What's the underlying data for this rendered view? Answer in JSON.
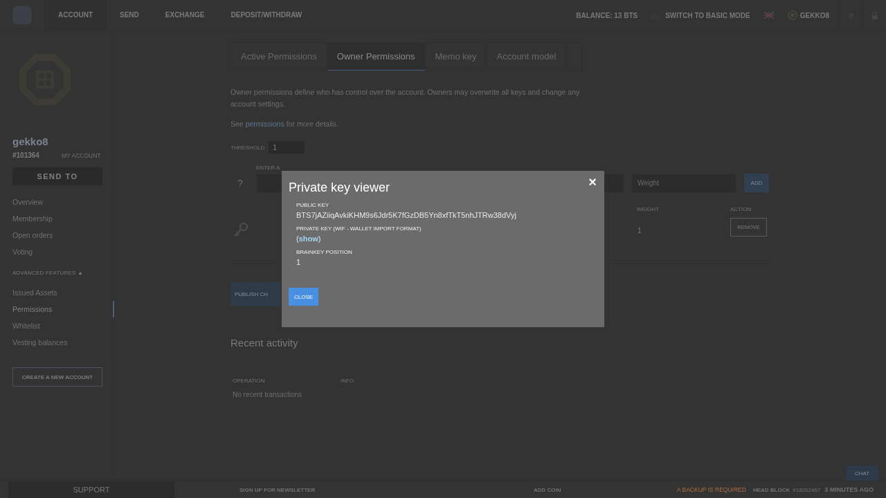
{
  "header": {
    "nav": [
      {
        "label": "ACCOUNT",
        "selected": true
      },
      {
        "label": "SEND",
        "selected": false
      },
      {
        "label": "EXCHANGE",
        "selected": false
      },
      {
        "label": "DEPOSIT/WITHDRAW",
        "selected": false
      }
    ],
    "balance": "BALANCE: 13 BTS",
    "mode": "SWITCH TO BASIC MODE",
    "account": "GEKKO8"
  },
  "sidebar": {
    "name": "gekko8",
    "id": "#101364",
    "my_account": "MY ACCOUNT",
    "send_button": "SEND TO",
    "items": [
      {
        "label": "Overview",
        "selected": false
      },
      {
        "label": "Membership",
        "selected": false
      },
      {
        "label": "Open orders",
        "selected": false
      },
      {
        "label": "Voting",
        "selected": false
      }
    ],
    "advanced_heading": "ADVANCED FEATURES ▲",
    "advanced_items": [
      {
        "label": "Issued Assets",
        "selected": false
      },
      {
        "label": "Permissions",
        "selected": true
      },
      {
        "label": "Whitelist",
        "selected": false
      },
      {
        "label": "Vesting balances",
        "selected": false
      }
    ],
    "create_button": "CREATE A NEW ACCOUNT"
  },
  "main": {
    "tabs": [
      {
        "label": "Active Permissions",
        "selected": false
      },
      {
        "label": "Owner Permissions",
        "selected": true
      },
      {
        "label": "Memo key",
        "selected": false
      },
      {
        "label": "Account model",
        "selected": false
      }
    ],
    "description": "Owner permissions define who has control over the account. Owners may overwrite all keys and change any account settings.",
    "see_prefix": "See",
    "see_link": "permissions",
    "see_suffix": "for more details.",
    "threshold_label": "THRESHOLD",
    "threshold_value": "1",
    "enter_label": "ENTER A",
    "help": "?",
    "weight_placeholder": "Weight",
    "add_button": "ADD",
    "columns": [
      "WEIGHT",
      "ACTION"
    ],
    "key_row": {
      "weight": "1",
      "action": "REMOVE"
    },
    "publish_button": "PUBLISH CH",
    "recent_title": "Recent activity",
    "recent_columns": [
      "OPERATION",
      "INFO"
    ],
    "recent_empty": "No recent transactions"
  },
  "modal": {
    "title": "Private key viewer",
    "close": "×",
    "fields": [
      {
        "label": "PUBLIC KEY",
        "kind": "text",
        "value": "BTS7jAZiiqAvkiKHM9s6Jdr5K7fGzDB5Yn8xfTkT5nhJTRw38dVyj"
      },
      {
        "label": "PRIVATE KEY (WIF - WALLET IMPORT FORMAT)",
        "kind": "link",
        "value": "(**show**)"
      },
      {
        "label": "BRAINKEY POSITION",
        "kind": "text",
        "value": "1"
      }
    ],
    "close_button": "CLOSE"
  },
  "footer": {
    "support": "SUPPORT",
    "newsletter": "SIGN UP FOR NEWSLETTER",
    "add_coin": "ADD COIN",
    "backup": "A BACKUP IS REQUIRED",
    "head_block": "HEAD BLOCK",
    "block_number": "#18262467",
    "time": "3 MINUTES AGO",
    "chat": "CHAT"
  }
}
